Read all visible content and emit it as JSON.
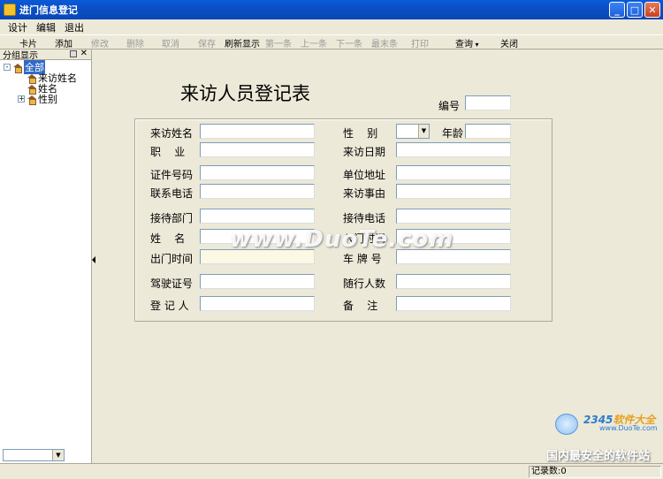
{
  "window": {
    "title": "进门信息登记"
  },
  "menu": [
    "设计",
    "编辑",
    "退出"
  ],
  "toolbar": [
    {
      "label": "卡片",
      "enabled": true
    },
    {
      "label": "添加",
      "enabled": true
    },
    {
      "label": "修改",
      "enabled": false
    },
    {
      "label": "删除",
      "enabled": false
    },
    {
      "label": "取消",
      "enabled": false
    },
    {
      "label": "保存",
      "enabled": false
    },
    {
      "label": "刷新显示",
      "enabled": true
    },
    {
      "label": "第一条",
      "enabled": false
    },
    {
      "label": "上一条",
      "enabled": false
    },
    {
      "label": "下一条",
      "enabled": false
    },
    {
      "label": "最末条",
      "enabled": false
    },
    {
      "label": "打印",
      "enabled": false
    },
    {
      "label": "查询",
      "enabled": true
    },
    {
      "label": "关闭",
      "enabled": true
    }
  ],
  "left_panel": {
    "header": "分组显示",
    "tree": [
      {
        "label": "全部",
        "expander": "-",
        "selected": true
      },
      {
        "label": "来访姓名",
        "expander": "",
        "selected": false
      },
      {
        "label": "姓名",
        "expander": "",
        "selected": false
      },
      {
        "label": "性别",
        "expander": "+",
        "selected": false
      }
    ]
  },
  "form": {
    "title": "来访人员登记表",
    "serial_label": "编号",
    "age_label": "年龄",
    "left_labels": [
      "来访姓名",
      "职    业",
      "证件号码",
      "联系电话",
      "接待部门",
      "姓    名",
      "出门时间",
      "驾驶证号",
      "登 记 人"
    ],
    "right_labels": [
      "性    别",
      "来访日期",
      "单位地址",
      "来访事由",
      "接待电话",
      "入门时间",
      "车 牌 号",
      "随行人数",
      "备    注"
    ]
  },
  "watermark": "www.DuoTe.com",
  "brand": {
    "logo_num": "2345",
    "logo_text": "软件大全",
    "url": "www.DuoTe.com",
    "slogan": "国内最安全的软件站"
  },
  "status": {
    "record_count": "记录数:0"
  }
}
